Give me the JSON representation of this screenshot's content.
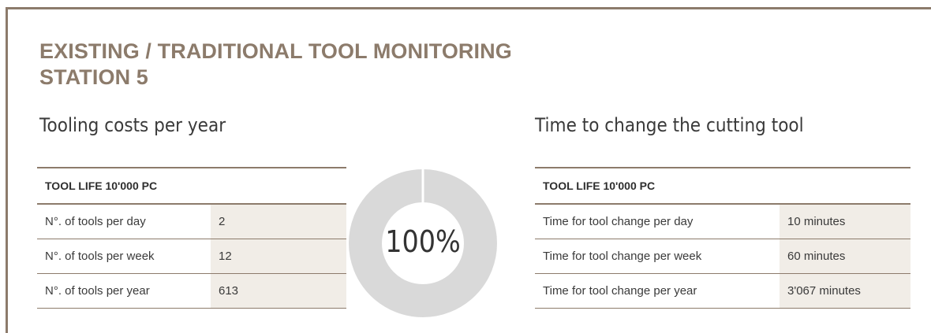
{
  "title": {
    "line1": "EXISTING / TRADITIONAL TOOL MONITORING",
    "line2": "STATION 5"
  },
  "left_section": {
    "heading": "Tooling costs per year",
    "table": {
      "header": "TOOL LIFE 10'000 PC",
      "rows": [
        {
          "label": "N°. of tools per day",
          "value": "2"
        },
        {
          "label": "N°. of tools per week",
          "value": "12"
        },
        {
          "label": "N°. of tools per year",
          "value": "613"
        }
      ]
    }
  },
  "donut": {
    "label": "100%",
    "fraction": 1.0,
    "color": "#d9d9d9"
  },
  "right_section": {
    "heading": "Time to change the cutting tool",
    "table": {
      "header": "TOOL LIFE 10'000 PC",
      "rows": [
        {
          "label": "Time for tool change per day",
          "value": "10 minutes"
        },
        {
          "label": "Time for tool change per week",
          "value": "60 minutes"
        },
        {
          "label": "Time for tool change per year",
          "value": "3'067 minutes"
        }
      ]
    }
  },
  "colors": {
    "accent": "#8c7b6b",
    "value_cell_background": "#f1ede7",
    "text": "#3a3a3a"
  }
}
